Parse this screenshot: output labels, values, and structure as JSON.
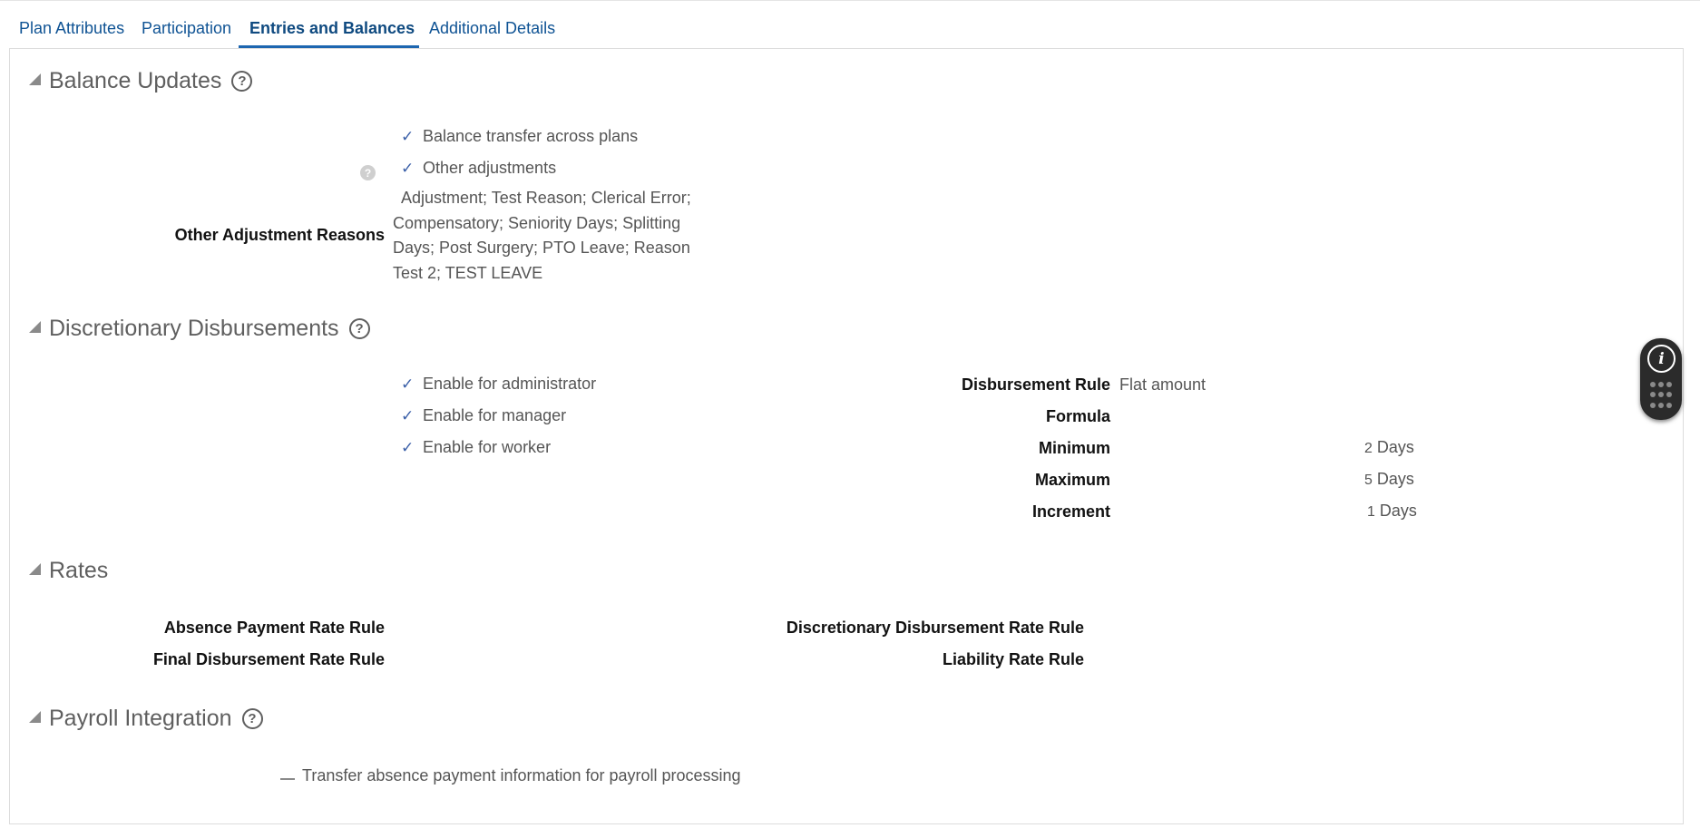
{
  "tabs": [
    {
      "label": "Plan Attributes"
    },
    {
      "label": "Participation"
    },
    {
      "label": "Entries and Balances"
    },
    {
      "label": "Additional Details"
    }
  ],
  "balance_updates": {
    "title": "Balance Updates",
    "checks": [
      {
        "label": "Balance transfer across plans"
      },
      {
        "label": "Other adjustments"
      }
    ],
    "other_adjustment_reasons_label": "Other Adjustment Reasons",
    "other_adjustment_reasons_value": "Adjustment; Test Reason; Clerical Error; Compensatory; Seniority Days; Splitting Days; Post Surgery; PTO Leave; Reason Test 2; TEST LEAVE"
  },
  "discretionary": {
    "title": "Discretionary Disbursements",
    "checks": [
      {
        "label": "Enable for administrator"
      },
      {
        "label": "Enable for manager"
      },
      {
        "label": "Enable for worker"
      }
    ],
    "disbursement_rule_label": "Disbursement Rule",
    "disbursement_rule_value": "Flat amount",
    "formula_label": "Formula",
    "minimum_label": "Minimum",
    "minimum_value": "2",
    "maximum_label": "Maximum",
    "maximum_value": "5",
    "increment_label": "Increment",
    "increment_value": "1",
    "unit": "Days"
  },
  "rates": {
    "title": "Rates",
    "absence_payment_rate_rule": "Absence Payment Rate Rule",
    "final_disbursement_rate_rule": "Final Disbursement Rate Rule",
    "discretionary_disbursement_rate_rule": "Discretionary Disbursement Rate Rule",
    "liability_rate_rule": "Liability Rate Rule"
  },
  "payroll": {
    "title": "Payroll Integration",
    "transfer_label": "Transfer absence payment information for payroll processing"
  }
}
